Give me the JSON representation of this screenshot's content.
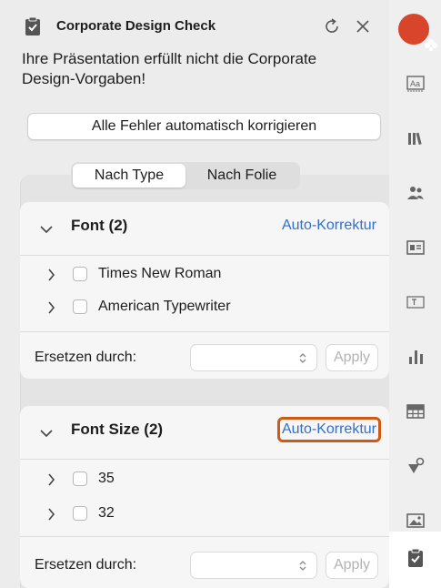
{
  "panel": {
    "title": "Corporate Design Check",
    "message": "Ihre Präsentation erfüllt nicht die Corporate Design-Vorgaben!",
    "autofix_label": "Alle Fehler automatisch korrigieren"
  },
  "tabs": {
    "by_type": "Nach Type",
    "by_slide": "Nach Folie",
    "selected": "Nach Type"
  },
  "cards": [
    {
      "title": "Font (2)",
      "action": "Auto-Korrektur",
      "items": [
        "Times New Roman",
        "American Typewriter"
      ],
      "replace_label": "Ersetzen durch:",
      "replace_value": "",
      "apply_label": "Apply"
    },
    {
      "title": "Font Size (2)",
      "action": "Auto-Korrektur",
      "items": [
        "35",
        "32"
      ],
      "replace_label": "Ersetzen durch:",
      "replace_value": "",
      "apply_label": "Apply"
    }
  ],
  "toolbar": {
    "items": [
      "addin-logo",
      "text-style-icon",
      "library-icon",
      "people-icon",
      "layout-icon",
      "textbox-icon",
      "chart-icon",
      "table-icon",
      "shapes-icon",
      "image-icon",
      "check-clipboard-icon"
    ],
    "active": "check-clipboard-icon"
  },
  "colors": {
    "link": "#2f6fd6",
    "highlight": "#d05a14",
    "brand": "#d8452a"
  }
}
